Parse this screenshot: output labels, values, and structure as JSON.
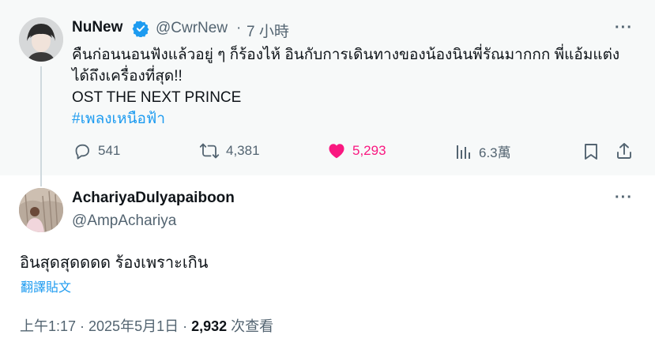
{
  "parent_tweet": {
    "author_name": "NuNew",
    "handle": "@CwrNew",
    "separator": "·",
    "time_ago": "7 小時",
    "text_line1": "คืนก่อนนอนฟังแล้วอยู่ ๆ ก็ร้องไห้ อินกับการเดินทางของน้องนินพี่รัณมากกก พี่แอ้มแต่ง",
    "text_line2": "ได้ถึงเครื่องที่สุด!!",
    "text_line3": "OST THE NEXT PRINCE",
    "hashtag": "#เพลงเหนือฟ้า",
    "replies": "541",
    "reposts": "4,381",
    "likes": "5,293",
    "views": "6.3萬",
    "more_label": "···"
  },
  "reply_tweet": {
    "author_name": "AchariyaDulyapaiboon",
    "handle": "@AmpAchariya",
    "text": "อินสุดสุดดดด ร้องเพราะเกิน",
    "translate_label": "翻譯貼文",
    "timestamp": "上午1:17 · 2025年5月1日 · ",
    "view_count": "2,932",
    "view_suffix": " 次查看",
    "more_label": "···"
  },
  "colors": {
    "accent": "#1d9bf0",
    "like": "#f91880",
    "secondary_text": "#536471",
    "primary_text": "#0f1419"
  }
}
